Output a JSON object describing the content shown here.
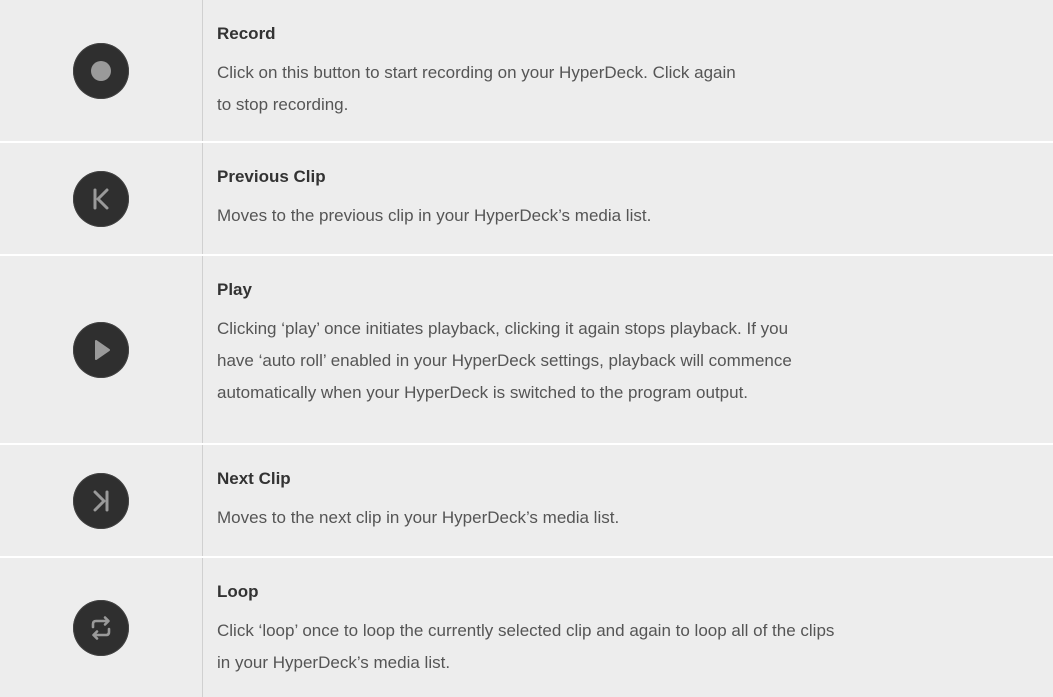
{
  "rows": [
    {
      "icon": "record-icon",
      "title": "Record",
      "lines": [
        "Click on this button to start recording on your HyperDeck. Click again",
        "to stop recording."
      ]
    },
    {
      "icon": "previous-clip-icon",
      "title": "Previous Clip",
      "lines": [
        "Moves to the previous clip in your HyperDeck’s media list."
      ]
    },
    {
      "icon": "play-icon",
      "title": "Play",
      "lines": [
        "Clicking ‘play’ once initiates playback, clicking it again stops playback. If you",
        "have ‘auto roll’ enabled in your HyperDeck settings, playback will commence",
        "automatically when your HyperDeck is switched to the program output."
      ]
    },
    {
      "icon": "next-clip-icon",
      "title": "Next Clip",
      "lines": [
        "Moves to the next clip in your HyperDeck’s media list."
      ]
    },
    {
      "icon": "loop-icon",
      "title": "Loop",
      "lines": [
        "Click ‘loop’ once to loop the currently selected clip and again to loop all of the clips",
        "in your HyperDeck’s media list."
      ]
    }
  ]
}
